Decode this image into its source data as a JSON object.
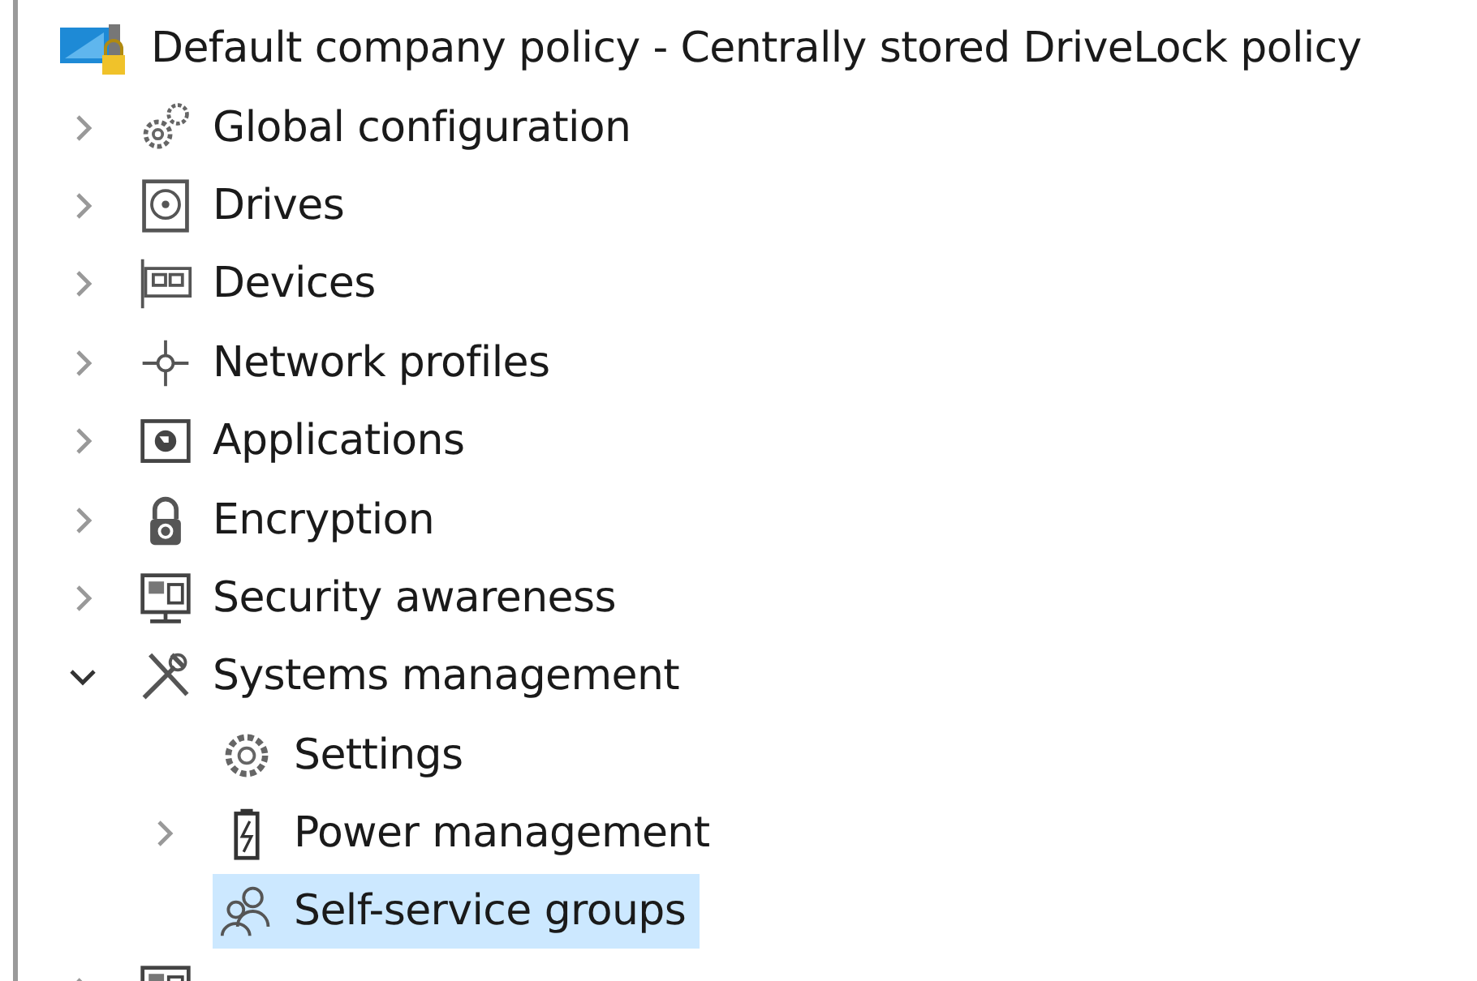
{
  "tree": {
    "label": "Default company policy - Centrally stored DriveLock policy",
    "kind": "policy",
    "selected": false,
    "children": [
      {
        "label": "Global configuration",
        "kind": "gears",
        "expanded": false,
        "selected": false
      },
      {
        "label": "Drives",
        "kind": "drive",
        "expanded": false,
        "selected": false
      },
      {
        "label": "Devices",
        "kind": "card",
        "expanded": false,
        "selected": false
      },
      {
        "label": "Network profiles",
        "kind": "network",
        "expanded": false,
        "selected": false
      },
      {
        "label": "Applications",
        "kind": "globe",
        "expanded": false,
        "selected": false
      },
      {
        "label": "Encryption",
        "kind": "lock",
        "expanded": false,
        "selected": false
      },
      {
        "label": "Security awareness",
        "kind": "monitor",
        "expanded": false,
        "selected": false
      },
      {
        "label": "Systems management",
        "kind": "tools",
        "expanded": true,
        "selected": false,
        "children": [
          {
            "label": "Settings",
            "kind": "gear",
            "selected": false
          },
          {
            "label": "Power management",
            "kind": "battery",
            "expanded": false,
            "selected": false
          },
          {
            "label": "Self-service groups",
            "kind": "users",
            "selected": true
          }
        ]
      },
      {
        "kind": "monitor",
        "expanded": false,
        "selected": false
      }
    ]
  }
}
